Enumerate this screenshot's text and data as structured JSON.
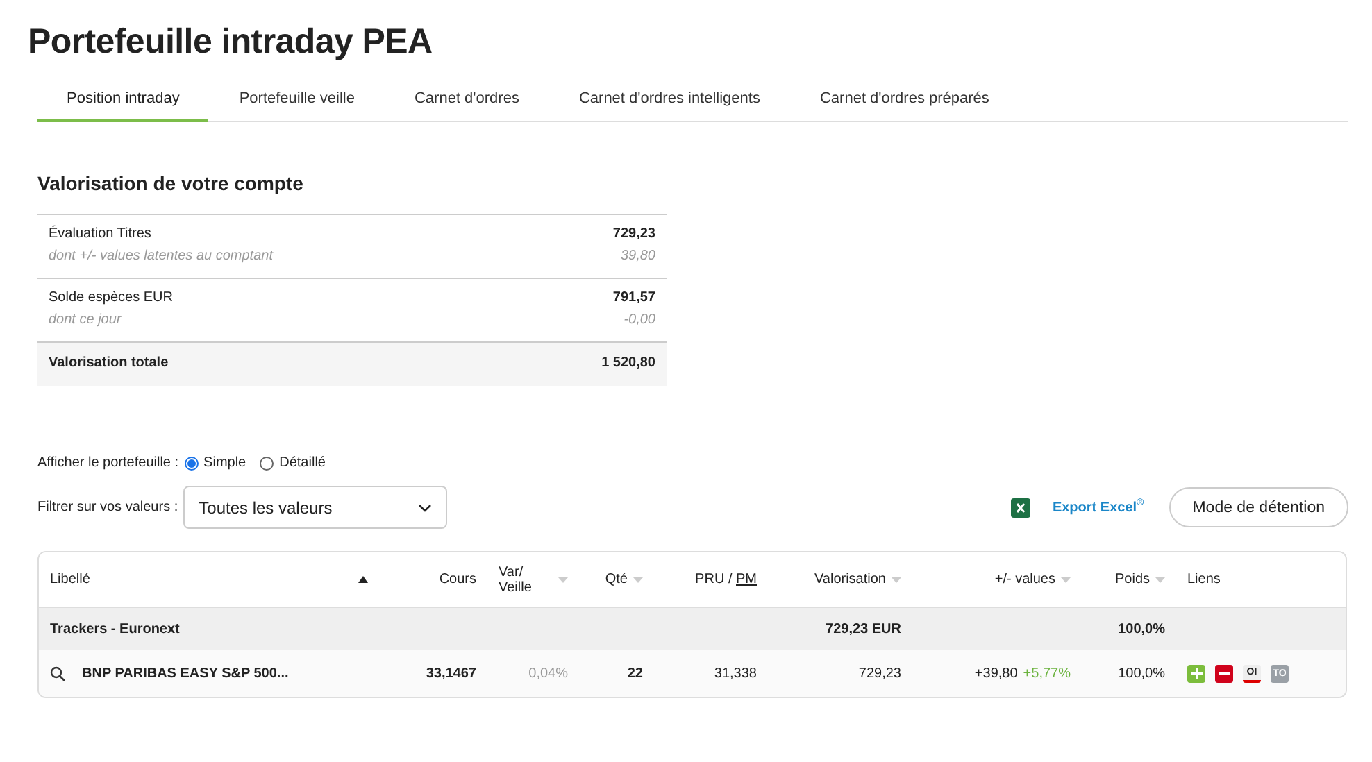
{
  "page_title": "Portefeuille intraday PEA",
  "tabs": [
    {
      "label": "Position intraday",
      "selected": true
    },
    {
      "label": "Portefeuille veille",
      "selected": false
    },
    {
      "label": "Carnet d'ordres",
      "selected": false
    },
    {
      "label": "Carnet d'ordres intelligents",
      "selected": false
    },
    {
      "label": "Carnet d'ordres préparés",
      "selected": false
    }
  ],
  "account": {
    "title": "Valorisation de votre compte",
    "groups": [
      {
        "label": "Évaluation Titres",
        "value": "729,23",
        "sub_label": "dont +/- values latentes au comptant",
        "sub_value": "39,80"
      },
      {
        "label": "Solde espèces EUR",
        "value": "791,57",
        "sub_label": "dont ce jour",
        "sub_value": "-0,00"
      }
    ],
    "total": {
      "label": "Valorisation totale",
      "value": "1 520,80"
    }
  },
  "display": {
    "label": "Afficher le portefeuille :",
    "options": [
      {
        "label": "Simple",
        "selected": true
      },
      {
        "label": "Détaillé",
        "selected": false
      }
    ]
  },
  "filter": {
    "label": "Filtrer sur vos valeurs :",
    "value": "Toutes les valeurs"
  },
  "export_link": "Export Excel$^{®}$",
  "mode_button": "Mode de détention",
  "table": {
    "columns": [
      {
        "lines": [
          "Libellé"
        ],
        "sorted": true,
        "numeric": false
      },
      {
        "lines": [
          "Cours"
        ],
        "sortable": false,
        "sorted": false,
        "numeric": true
      },
      {
        "lines": [
          "Var/",
          "Veille"
        ],
        "sortable": true,
        "sorted": false,
        "numeric": false
      },
      {
        "lines": [
          "Qté"
        ],
        "sortable": true,
        "sorted": false,
        "numeric": true
      },
      {
        "lines": [
          "PRU /"
        ],
        "link": "PM",
        "sortable": false,
        "sorted": false,
        "numeric": true
      },
      {
        "lines": [
          "Valorisation"
        ],
        "sortable": true,
        "sorted": false,
        "numeric": true
      },
      {
        "lines": [
          "+/- values"
        ],
        "sortable": true,
        "sorted": false,
        "numeric": true
      },
      {
        "lines": [
          "Poids"
        ],
        "sortable": true,
        "sorted": false,
        "numeric": true
      },
      {
        "lines": [
          "Liens"
        ],
        "sortable": false,
        "sorted": false,
        "numeric": false
      }
    ],
    "group": {
      "name": "Trackers - Euronext",
      "valorisation": "729,23 EUR",
      "poids": "100,0%"
    },
    "rows": [
      {
        "name": "BNP PARIBAS EASY S&P 500...",
        "cours": "33,1467",
        "var": "0,04%",
        "qte": "22",
        "pru": "31,338",
        "valorisation": "729,23",
        "pv": "+39,80",
        "pv_pct": "+5,77%",
        "poids": "100,0%",
        "links": [
          {
            "kind": "add"
          },
          {
            "kind": "remove"
          },
          {
            "kind": "outline",
            "label": "OI"
          },
          {
            "kind": "grey",
            "label": "TO"
          }
        ]
      }
    ]
  }
}
